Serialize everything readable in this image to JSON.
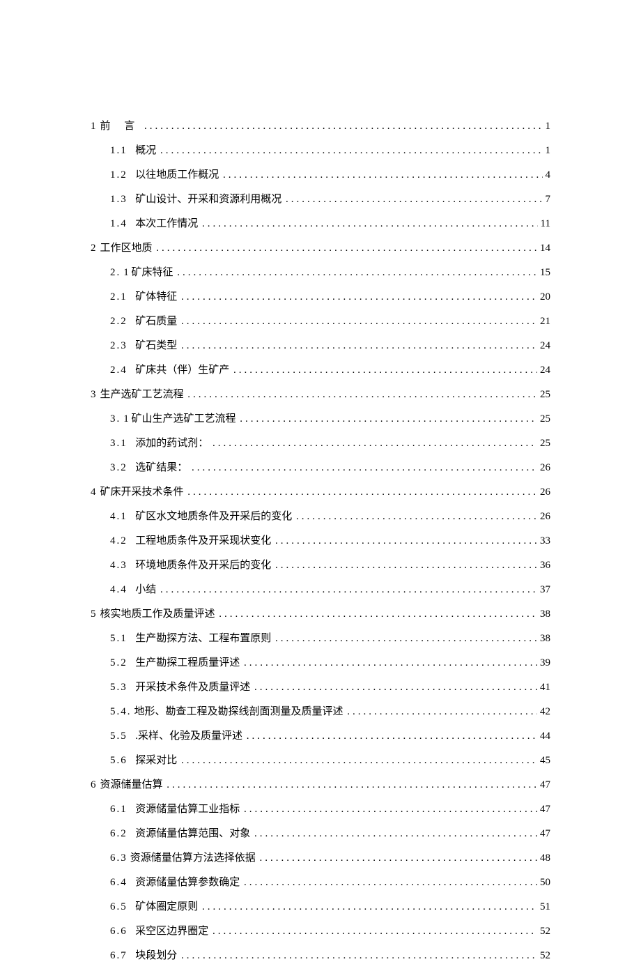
{
  "toc": [
    {
      "level": 1,
      "num": "1",
      "label": "前 言",
      "spaced": true,
      "page": "1"
    },
    {
      "level": 2,
      "num": "1.1",
      "label": "概况",
      "page": "1"
    },
    {
      "level": 2,
      "num": "1.2",
      "label": "以往地质工作概况",
      "page": "4"
    },
    {
      "level": 2,
      "num": "1.3",
      "label": "矿山设计、开采和资源利用概况",
      "page": "7"
    },
    {
      "level": 2,
      "num": "1.4",
      "label": "本次工作情况",
      "page": "11"
    },
    {
      "level": 1,
      "num": "2",
      "label": "工作区地质",
      "page": "14"
    },
    {
      "level": 2,
      "num": "2.",
      "label": "1 矿床特征",
      "nospace": true,
      "page": "15"
    },
    {
      "level": 2,
      "num": "2.1",
      "label": "矿体特征",
      "page": "20"
    },
    {
      "level": 2,
      "num": "2.2",
      "label": "矿石质量",
      "page": "21"
    },
    {
      "level": 2,
      "num": "2.3",
      "label": "矿石类型",
      "page": "24"
    },
    {
      "level": 2,
      "num": "2.4",
      "label": "矿床共（伴）生矿产",
      "page": "24"
    },
    {
      "level": 1,
      "num": "3",
      "label": "生产选矿工艺流程",
      "page": "25"
    },
    {
      "level": 2,
      "num": "3.",
      "label": "1 矿山生产选矿工艺流程",
      "nospace": true,
      "page": "25"
    },
    {
      "level": 2,
      "num": "3.1",
      "label": "添加的药试剂：",
      "page": "25"
    },
    {
      "level": 2,
      "num": "3.2",
      "label": "选矿结果：",
      "page": "26"
    },
    {
      "level": 1,
      "num": "4",
      "label": "矿床开采技术条件",
      "page": "26"
    },
    {
      "level": 2,
      "num": "4.1",
      "label": "矿区水文地质条件及开采后的变化",
      "page": "26"
    },
    {
      "level": 2,
      "num": "4.2",
      "label": "工程地质条件及开采现状变化",
      "page": "33"
    },
    {
      "level": 2,
      "num": "4.3",
      "label": "环境地质条件及开采后的变化",
      "page": "36"
    },
    {
      "level": 2,
      "num": "4.4",
      "label": "小结",
      "page": "37"
    },
    {
      "level": 1,
      "num": "5",
      "label": "核实地质工作及质量评述",
      "page": "38"
    },
    {
      "level": 2,
      "num": "5.1",
      "label": "生产勘探方法、工程布置原则",
      "page": "38"
    },
    {
      "level": 2,
      "num": "5.2",
      "label": "生产勘探工程质量评述",
      "page": "39"
    },
    {
      "level": 2,
      "num": "5.3",
      "label": "开采技术条件及质量评述",
      "page": "41"
    },
    {
      "level": 2,
      "num": "5.4.",
      "label": "地形、勘查工程及勘探线剖面测量及质量评述",
      "nospace": true,
      "page": "42"
    },
    {
      "level": 2,
      "num": "5.5",
      "label": ".采样、化验及质量评述",
      "page": "44"
    },
    {
      "level": 2,
      "num": "5.6",
      "label": "探采对比",
      "page": "45"
    },
    {
      "level": 1,
      "num": "6",
      "label": "资源储量估算",
      "page": "47"
    },
    {
      "level": 2,
      "num": "6.1",
      "label": "资源储量估算工业指标",
      "page": "47"
    },
    {
      "level": 2,
      "num": "6.2",
      "label": "资源储量估算范围、对象",
      "page": "47"
    },
    {
      "level": 2,
      "num": "6.3",
      "label": "资源储量估算方法选择依据",
      "nospace": true,
      "page": "48"
    },
    {
      "level": 2,
      "num": "6.4",
      "label": "资源储量估算参数确定",
      "page": "50"
    },
    {
      "level": 2,
      "num": "6.5",
      "label": "矿体圈定原则",
      "page": "51"
    },
    {
      "level": 2,
      "num": "6.6",
      "label": "采空区边界圈定",
      "page": "52"
    },
    {
      "level": 2,
      "num": "6.7",
      "label": "块段划分",
      "page": "52"
    }
  ]
}
